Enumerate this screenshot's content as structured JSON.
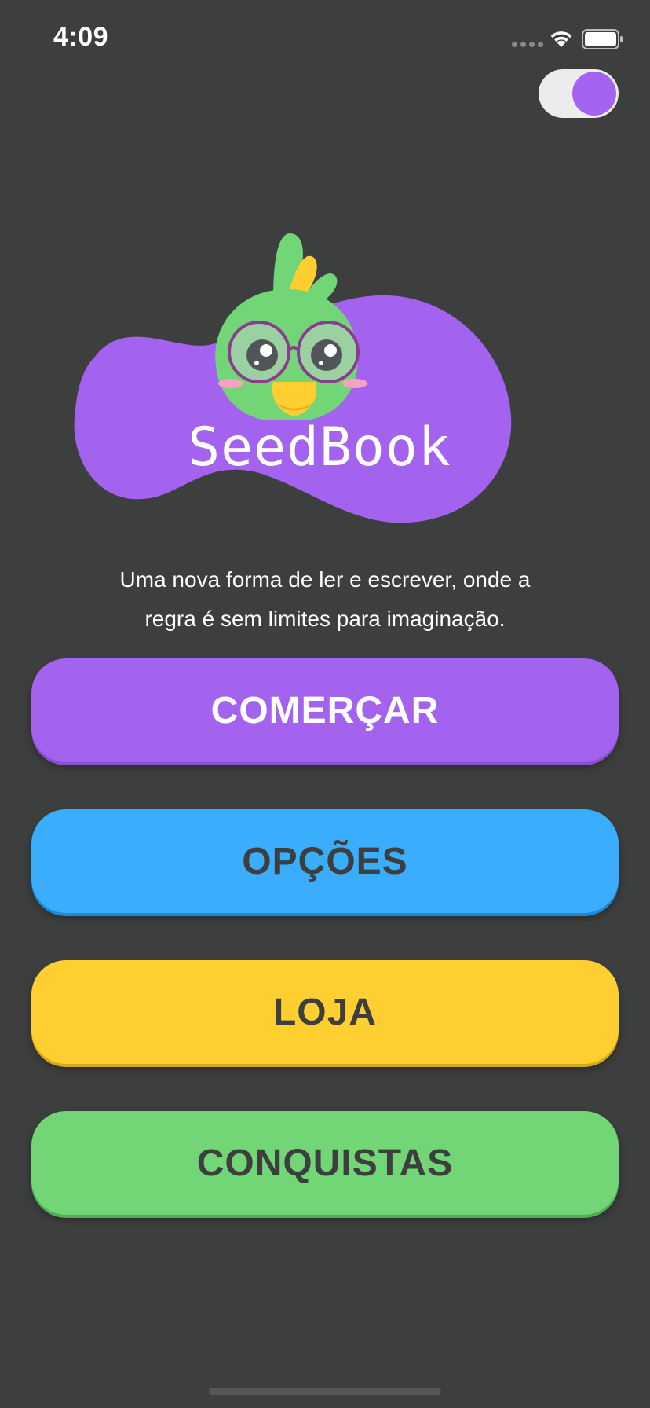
{
  "status_bar": {
    "time": "4:09"
  },
  "theme_toggle": {
    "state": "on",
    "knob_color": "#a463ee"
  },
  "brand": {
    "name": "SeedBook",
    "mascot": "green-bird-with-glasses"
  },
  "tagline": {
    "line1": "Uma nova forma de ler e escrever, onde a",
    "line2": "regra é sem limites para imaginação."
  },
  "menu": {
    "start_label": "COMERÇAR",
    "options_label": "OPÇÕES",
    "shop_label": "LOJA",
    "achievements_label": "CONQUISTAS"
  },
  "colors": {
    "background": "#3d3e3e",
    "purple": "#a463ee",
    "blue": "#3aadfd",
    "yellow": "#ffcf32",
    "green": "#72d677"
  }
}
